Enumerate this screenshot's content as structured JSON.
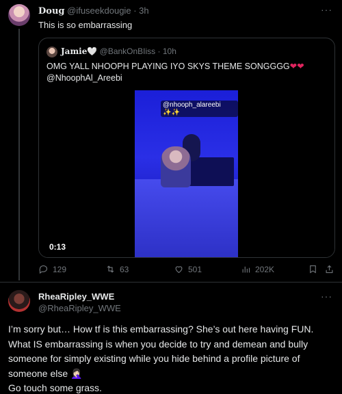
{
  "colors": {
    "background": "#000000",
    "text": "#e7e9ea",
    "muted": "#71767b",
    "border": "#2f3336",
    "heart": "#e0245e"
  },
  "tweet1": {
    "name": "Doug",
    "handle": "@ifuseekdougie",
    "time": "· 3h",
    "text": "This is so embarrassing",
    "more": "···",
    "quote": {
      "name": "Jamie🤍",
      "handle": "@BankOnBIiss",
      "time": "· 10h",
      "text": "OMG YALL NHOOPH PLAYING IYO SKYS THEME SONGGGG",
      "hearts": "❤❤",
      "mention": "@NhoophAl_Areebi",
      "video_tag": "@nhooph_alareebi ✨✨",
      "video_time": "0:13"
    },
    "actions": {
      "replies": "129",
      "retweets": "63",
      "likes": "501",
      "views": "202K"
    }
  },
  "tweet2": {
    "name": "RheaRipley_WWE",
    "handle": "@RheaRipley_WWE",
    "more": "···",
    "lines": [
      "I’m sorry but… How tf is this embarrassing? She’s out here having FUN.",
      "What IS embarrassing is when you decide to try and demean and bully",
      "someone for simply existing while you hide behind a profile picture of",
      "someone else 🤦🏻‍♀️",
      "Go touch some grass."
    ]
  }
}
